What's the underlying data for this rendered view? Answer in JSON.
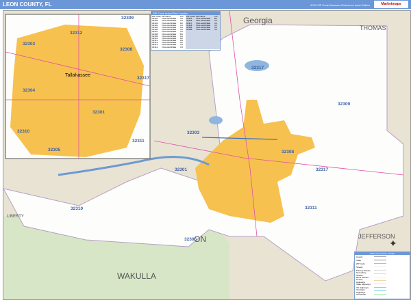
{
  "header": {
    "title": "LEON COUNTY, FL",
    "edition": "2020 ZIP Code Business Reference Inset Edition",
    "logo": "Marketmaps"
  },
  "map": {
    "regions": {
      "georgia": "Georgia",
      "thomas": "THOMAS",
      "liberty": "LIBERTY",
      "jefferson": "JEFFERSON",
      "wakulla": "WAKULLA",
      "leon": "ON"
    },
    "zip_labels": [
      "32317",
      "32309",
      "32303",
      "32308",
      "32301",
      "32317",
      "32311",
      "32310",
      "32305"
    ],
    "inset": {
      "city": "Tallahassee",
      "zip_labels": [
        "32309",
        "32312",
        "32303",
        "32308",
        "32317",
        "32304",
        "32301",
        "32310",
        "32311",
        "32305"
      ]
    },
    "colors": {
      "urban": "#f7c14f",
      "county": "#ffffff",
      "land": "#e9e3d3",
      "wakulla": "#d7e6c6",
      "water": "#8fb6de",
      "header": "#6b96d8"
    }
  },
  "zip_table": {
    "title": "ZIP Code Index/Grid Locator",
    "headers": [
      "ZIP Code",
      "ZIP Name",
      "Loc"
    ],
    "left": [
      [
        "32301",
        "TALLAHASSEE",
        "C3"
      ],
      [
        "32302",
        "TALLAHASSEE",
        "C3"
      ],
      [
        "32303",
        "TALLAHASSEE",
        "B3"
      ],
      [
        "32304",
        "TALLAHASSEE",
        "C3"
      ],
      [
        "32305",
        "TALLAHASSEE",
        "D3"
      ],
      [
        "32306",
        "TALLAHASSEE",
        "C3"
      ],
      [
        "32307",
        "TALLAHASSEE",
        "C3"
      ],
      [
        "32308",
        "TALLAHASSEE",
        "B4"
      ],
      [
        "32309",
        "TALLAHASSEE",
        "A4"
      ],
      [
        "32310",
        "TALLAHASSEE",
        "D2"
      ],
      [
        "32311",
        "TALLAHASSEE",
        "D4"
      ],
      [
        "32312",
        "TALLAHASSEE",
        "A3"
      ],
      [
        "32313",
        "TALLAHASSEE",
        "C3"
      ],
      [
        "32314",
        "TALLAHASSEE",
        "C3"
      ]
    ],
    "right": [
      [
        "32315",
        "TALLAHASSEE",
        "B3"
      ],
      [
        "32316",
        "TALLAHASSEE",
        "C3"
      ],
      [
        "32317",
        "TALLAHASSEE",
        "C4"
      ],
      [
        "32318",
        "TALLAHASSEE",
        "C3"
      ],
      [
        "32395",
        "TALLAHASSEE",
        "C3"
      ],
      [
        "32399",
        "TALLAHASSEE",
        "C3"
      ]
    ]
  },
  "legend": {
    "title": "2020 Leon County, FL Map",
    "items": [
      "County",
      "State",
      "ZIP Code",
      "Streets",
      "Primary Streets",
      "Secondary Streets",
      "Minor Streets",
      "County Highways",
      "State Highways",
      "US Highways",
      "Interstate Highways",
      "Toll Roads"
    ],
    "colors": [
      "#aaaaaa",
      "#888888",
      "#9fc0e8",
      "#eeeeee",
      "#dddddd",
      "#dddddd",
      "#eeeeee",
      "#f4d9a8",
      "#f9c9e8",
      "#f49ad0",
      "#7fd7f0",
      "#9fe7a0"
    ]
  }
}
